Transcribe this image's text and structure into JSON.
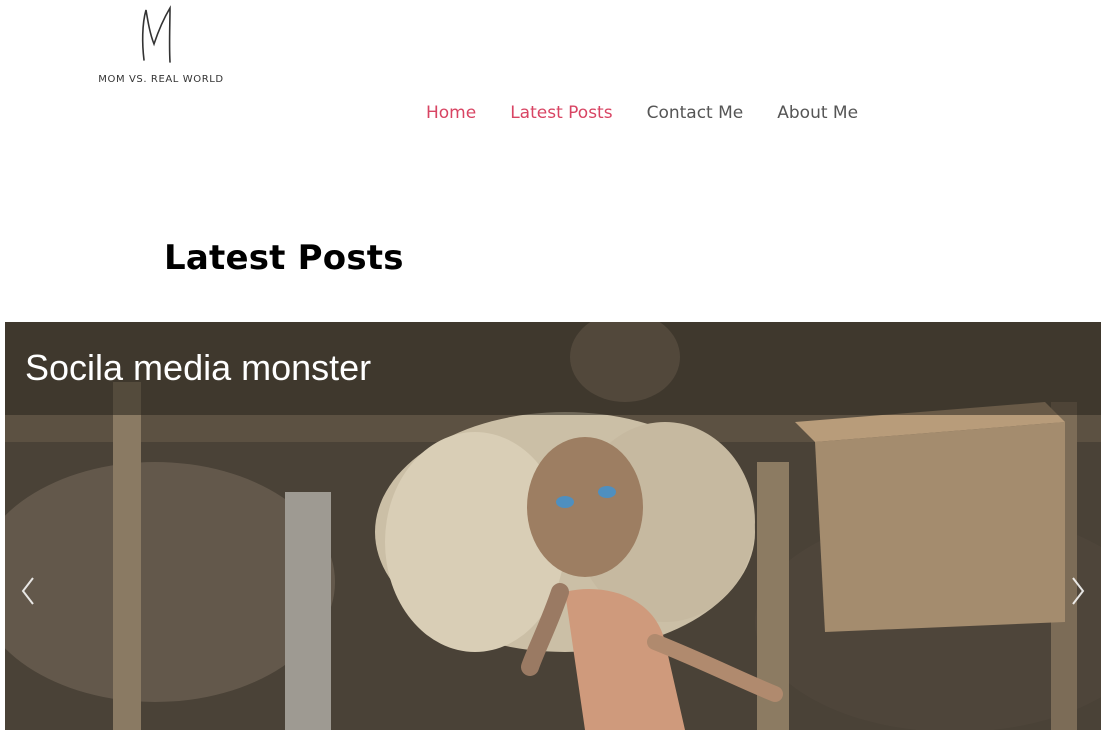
{
  "logo": {
    "mark": "M",
    "text": "MOM VS. REAL WORLD"
  },
  "nav": {
    "items": [
      {
        "label": "Home",
        "active": true
      },
      {
        "label": "Latest Posts",
        "active": true
      },
      {
        "label": "Contact Me",
        "active": false
      },
      {
        "label": "About Me",
        "active": false
      }
    ]
  },
  "section": {
    "title": "Latest Posts"
  },
  "slider": {
    "slide_caption": "Socila media monster",
    "prev_icon": "chevron-left-icon",
    "next_icon": "chevron-right-icon"
  },
  "colors": {
    "accent": "#d84463",
    "nav_text": "#555555",
    "title": "#000000"
  }
}
